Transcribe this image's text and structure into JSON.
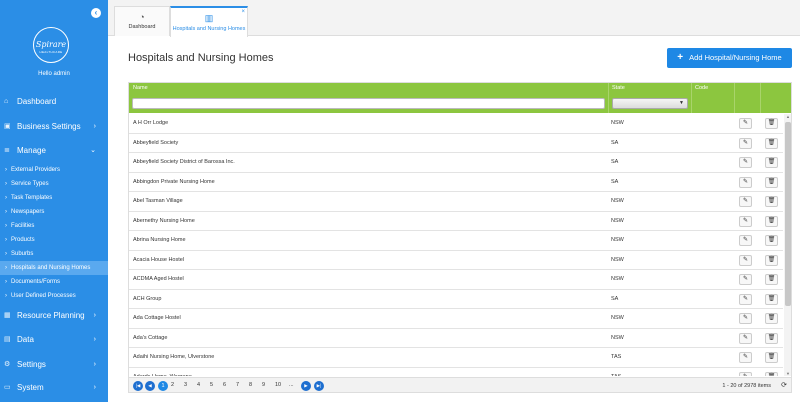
{
  "sidebar": {
    "collapse_icon": "chevron-left-icon",
    "logo_text": "Spirare",
    "logo_sub": "HEALTHCARE",
    "hello": "Hello admin",
    "main_items": [
      {
        "label": "Dashboard",
        "icon": "home-icon",
        "chev": ""
      },
      {
        "label": "Business Settings",
        "icon": "briefcase-icon",
        "chev": "›"
      },
      {
        "label": "Manage",
        "icon": "list-icon",
        "chev": "⌄"
      },
      {
        "label": "Resource Planning",
        "icon": "calendar-icon",
        "chev": "›"
      },
      {
        "label": "Data",
        "icon": "database-icon",
        "chev": "›"
      },
      {
        "label": "Settings",
        "icon": "gear-icon",
        "chev": "›"
      },
      {
        "label": "System",
        "icon": "monitor-icon",
        "chev": "›"
      }
    ],
    "sub_items": [
      "External Providers",
      "Service Types",
      "Task Templates",
      "Newspapers",
      "Facilities",
      "Products",
      "Suburbs",
      "Hospitals and Nursing Homes",
      "Documents/Forms",
      "User Defined Processes"
    ],
    "active_sub": "Hospitals and Nursing Homes"
  },
  "tabs": [
    {
      "label": "Dashboard",
      "icon": "gauge-icon"
    },
    {
      "label": "Hospitals and Nursing Homes",
      "icon": "building-icon",
      "close": "×"
    }
  ],
  "page": {
    "title": "Hospitals and Nursing Homes",
    "add_button": "Add Hospital/Nursing Home"
  },
  "grid": {
    "columns": [
      "Name",
      "State",
      "Code"
    ],
    "rows": [
      {
        "name": "A H Orr Lodge",
        "state": "NSW"
      },
      {
        "name": "Abbeyfield Society",
        "state": "SA"
      },
      {
        "name": "Abbeyfield Society District of Barossa Inc.",
        "state": "SA"
      },
      {
        "name": "Abbingdon Private Nursing Home",
        "state": "SA"
      },
      {
        "name": "Abel Tasman Village",
        "state": "NSW"
      },
      {
        "name": "Abernethy Nursing Home",
        "state": "NSW"
      },
      {
        "name": "Abrina Nursing Home",
        "state": "NSW"
      },
      {
        "name": "Acacia House Hostel",
        "state": "NSW"
      },
      {
        "name": "ACDMA Aged Hostel",
        "state": "NSW"
      },
      {
        "name": "ACH Group",
        "state": "SA"
      },
      {
        "name": "Ada Cottage Hostel",
        "state": "NSW"
      },
      {
        "name": "Ada's Cottage",
        "state": "NSW"
      },
      {
        "name": "Adaihi Nursing Home, Ulverstone",
        "state": "TAS"
      },
      {
        "name": "Adards Home, Wagrane",
        "state": "TAS"
      }
    ]
  },
  "pager": {
    "pages": [
      "1",
      "2",
      "3",
      "4",
      "5",
      "6",
      "7",
      "8",
      "9",
      "10",
      "..."
    ],
    "active_page": "1",
    "info": "1 - 20 of 2978 items"
  }
}
